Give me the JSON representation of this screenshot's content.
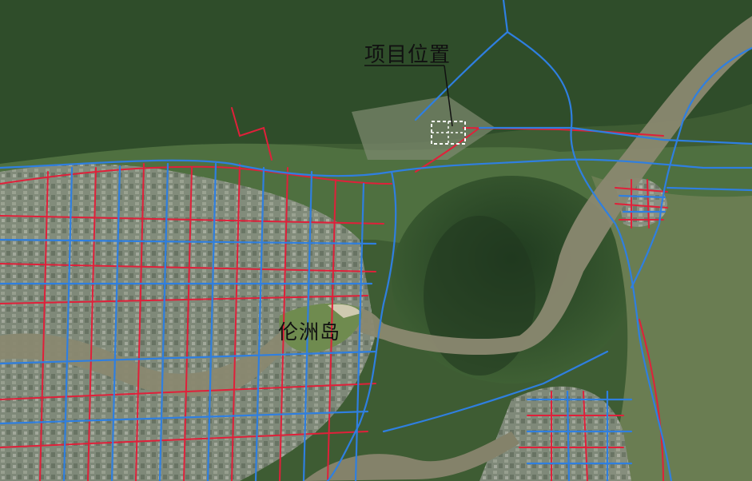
{
  "labels": {
    "project_location": "项目位置",
    "island_name": "伦洲岛"
  },
  "colors": {
    "vegetation_dark": "#2f4a28",
    "vegetation": "#4a6a3a",
    "urban": "#8d9487",
    "river": "#8b8a72",
    "road_blue": "#2f7fe0",
    "road_red": "#e0203a",
    "project_marker": "#ffffff"
  },
  "icons": [
    "project-site-marker",
    "leader-line"
  ]
}
